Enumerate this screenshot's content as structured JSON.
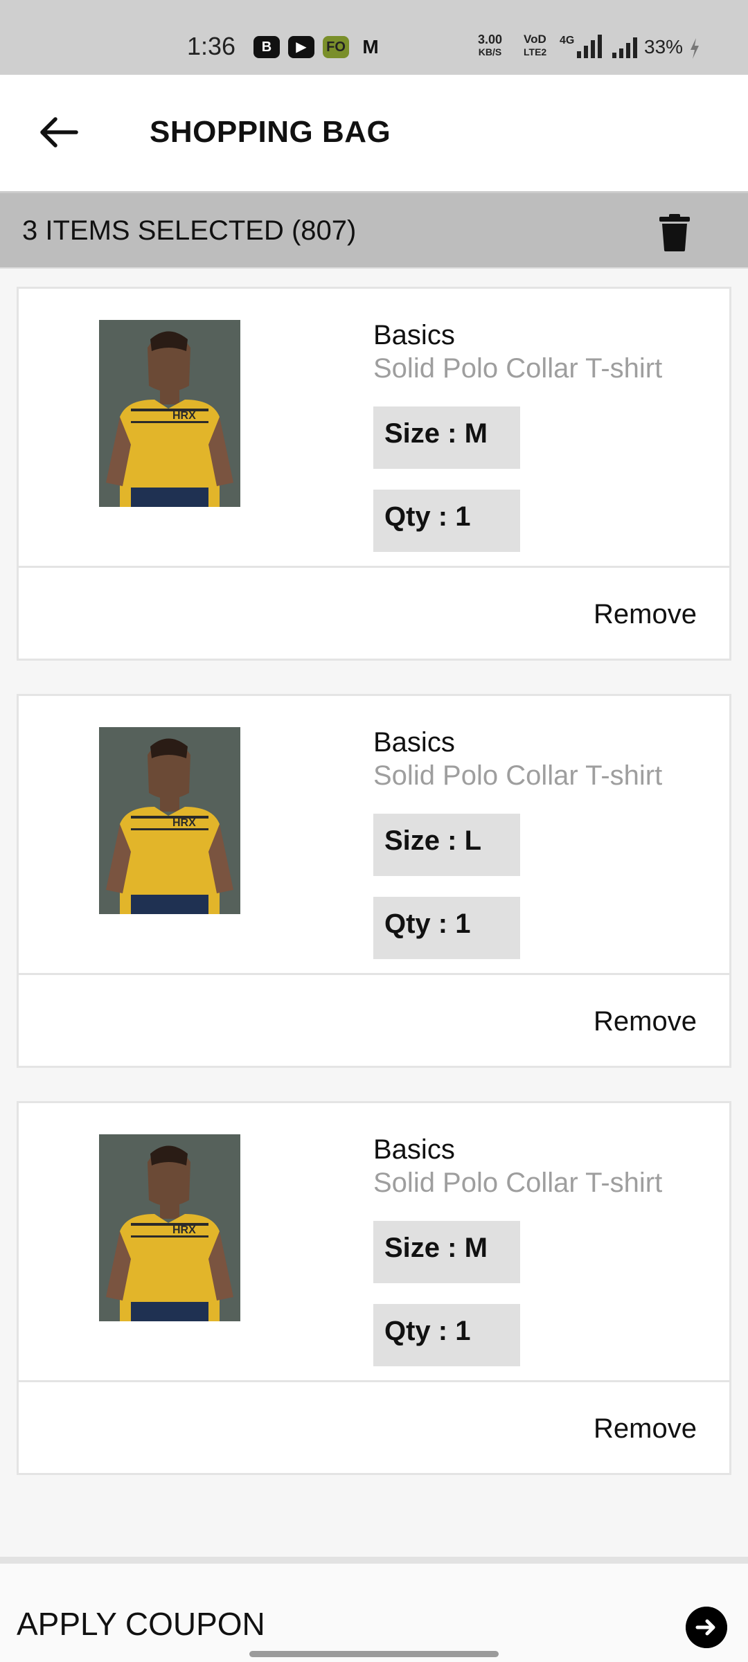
{
  "status_bar": {
    "time": "1:36",
    "app_icons": [
      "B",
      "▶",
      "FO",
      "M"
    ],
    "net_speed_value": "3.00",
    "net_speed_unit": "KB/S",
    "volte_line1": "VoD",
    "volte_line2": "LTE2",
    "network_type": "4G",
    "battery": "33%"
  },
  "app_bar": {
    "title": "SHOPPING BAG",
    "back_icon": "arrow-left-icon"
  },
  "selection_bar": {
    "text": "3 ITEMS SELECTED (807)",
    "delete_icon": "trash-icon"
  },
  "cart_items": [
    {
      "brand": "Basics",
      "name": "Solid Polo Collar T-shirt",
      "size": "Size : M",
      "qty": "Qty : 1",
      "remove_label": "Remove"
    },
    {
      "brand": "Basics",
      "name": "Solid Polo Collar T-shirt",
      "size": "Size : L",
      "qty": "Qty : 1",
      "remove_label": "Remove"
    },
    {
      "brand": "Basics",
      "name": "Solid Polo Collar T-shirt",
      "size": "Size : M",
      "qty": "Qty : 1",
      "remove_label": "Remove"
    }
  ],
  "product_image_text": "HRX",
  "coupon": {
    "label": "APPLY COUPON",
    "arrow_icon": "arrow-right-circle-icon"
  }
}
